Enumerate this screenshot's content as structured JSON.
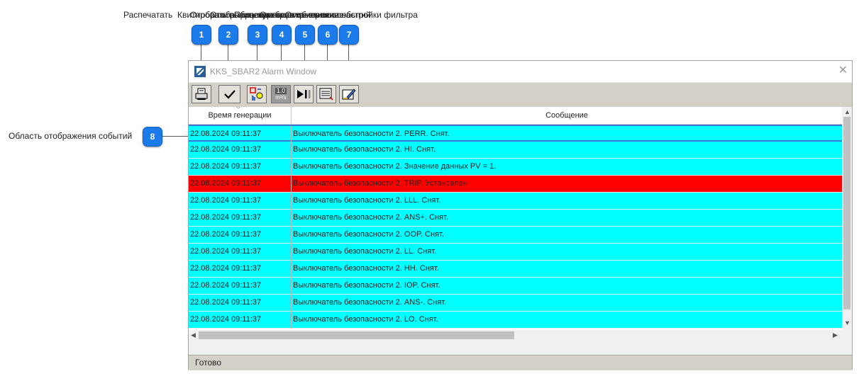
{
  "callouts": {
    "labels": [
      "Распечатать",
      "Квитировать выбранные",
      "Отобразить лицевую панель",
      "Отобразить единицы измерения",
      "Приостановить обновление",
      "Отобразить список событий",
      "Открыть окно настройки фильтра"
    ],
    "badges": [
      "1",
      "2",
      "3",
      "4",
      "5",
      "6",
      "7",
      "8"
    ],
    "side_label": "Область отображения событий",
    "badge_color": "#1b7bea"
  },
  "window": {
    "title": "KKS_SBAR2 Alarm Window",
    "close_icon": "close-icon"
  },
  "toolbar": {
    "buttons": [
      {
        "icon": "print-icon"
      },
      {
        "icon": "acknowledge-check-icon"
      },
      {
        "icon": "faceplate-icon"
      },
      {
        "icon": "units-icon",
        "value": "1.0",
        "unit": "m³/s"
      },
      {
        "icon": "pause-play-icon"
      },
      {
        "icon": "event-list-icon"
      },
      {
        "icon": "filter-settings-icon"
      }
    ]
  },
  "grid": {
    "columns": [
      "Время генерации",
      "Сообщение"
    ],
    "rows": [
      {
        "time": "22.08.2024 09:11:37",
        "message": "Выключатель безопасности 2. PERR. Снят.",
        "color": "#00ffff"
      },
      {
        "time": "22.08.2024 09:11:37",
        "message": "Выключатель безопасности 2. HI. Снят.",
        "color": "#00ffff"
      },
      {
        "time": "22.08.2024 09:11:37",
        "message": "Выключатель безопасности 2. Значение данных PV = 1.",
        "color": "#00ffff"
      },
      {
        "time": "22.08.2024 09:11:37",
        "message": "Выключатель безопасности 2. TRIP. Установлен",
        "color": "#ff0000"
      },
      {
        "time": "22.08.2024 09:11:37",
        "message": "Выключатель безопасности 2. LLL. Снят.",
        "color": "#00ffff"
      },
      {
        "time": "22.08.2024 09:11:37",
        "message": "Выключатель безопасности 2. ANS+. Снят.",
        "color": "#00ffff"
      },
      {
        "time": "22.08.2024 09:11:37",
        "message": "Выключатель безопасности 2. OOP. Снят.",
        "color": "#00ffff"
      },
      {
        "time": "22.08.2024 09:11:37",
        "message": "Выключатель безопасности 2. LL. Снят.",
        "color": "#00ffff"
      },
      {
        "time": "22.08.2024 09:11:37",
        "message": "Выключатель безопасности 2. HH. Снят.",
        "color": "#00ffff"
      },
      {
        "time": "22.08.2024 09:11:37",
        "message": "Выключатель безопасности 2. IOP. Снят.",
        "color": "#00ffff"
      },
      {
        "time": "22.08.2024 09:11:37",
        "message": "Выключатель безопасности 2. ANS-. Снят.",
        "color": "#00ffff"
      },
      {
        "time": "22.08.2024 09:11:37",
        "message": "Выключатель безопасности 2. LO. Снят.",
        "color": "#00ffff"
      }
    ]
  },
  "statusbar": {
    "text": "Готово"
  }
}
